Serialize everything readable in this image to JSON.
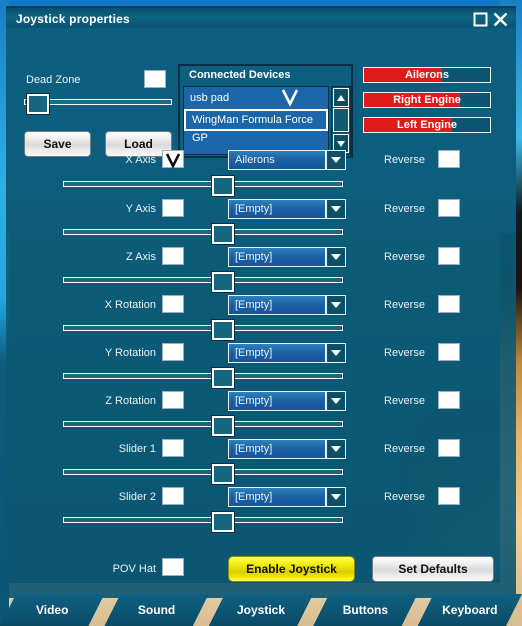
{
  "window": {
    "title": "Joystick properties",
    "maximize_icon": "maximize-icon",
    "close_icon": "close-icon"
  },
  "deadzone": {
    "label": "Dead Zone",
    "checkbox_checked": false,
    "slider_value": 2
  },
  "file_buttons": {
    "save": "Save",
    "load": "Load"
  },
  "connected_devices": {
    "header": "Connected Devices",
    "items": [
      {
        "label": "usb pad",
        "selected": false
      },
      {
        "label": "WingMan Formula Force GP",
        "selected": true
      },
      {
        "label": "",
        "selected": false
      }
    ],
    "scroll_up_icon": "scroll-up-icon",
    "scroll_down_icon": "scroll-down-icon"
  },
  "meters": [
    {
      "label": "Ailerons",
      "value": 62,
      "color": "#e01b1b"
    },
    {
      "label": "Right Engine",
      "value": 76,
      "color": "#e01b1b"
    },
    {
      "label": "Left Engine",
      "value": 70,
      "color": "#e01b1b"
    }
  ],
  "axes": [
    {
      "label": "X Axis",
      "enabled": true,
      "assignment": "Ailerons",
      "reverse_label": "Reverse",
      "reverse": false,
      "slider_value": 57
    },
    {
      "label": "Y Axis",
      "enabled": false,
      "assignment": "[Empty]",
      "reverse_label": "Reverse",
      "reverse": false,
      "slider_value": 57
    },
    {
      "label": "Z Axis",
      "enabled": false,
      "assignment": "[Empty]",
      "reverse_label": "Reverse",
      "reverse": false,
      "slider_value": 57
    },
    {
      "label": "X Rotation",
      "enabled": false,
      "assignment": "[Empty]",
      "reverse_label": "Reverse",
      "reverse": false,
      "slider_value": 57
    },
    {
      "label": "Y Rotation",
      "enabled": false,
      "assignment": "[Empty]",
      "reverse_label": "Reverse",
      "reverse": false,
      "slider_value": 57
    },
    {
      "label": "Z Rotation",
      "enabled": false,
      "assignment": "[Empty]",
      "reverse_label": "Reverse",
      "reverse": false,
      "slider_value": 57
    },
    {
      "label": "Slider 1",
      "enabled": false,
      "assignment": "[Empty]",
      "reverse_label": "Reverse",
      "reverse": false,
      "slider_value": 57
    },
    {
      "label": "Slider 2",
      "enabled": false,
      "assignment": "[Empty]",
      "reverse_label": "Reverse",
      "reverse": false,
      "slider_value": 57
    }
  ],
  "pov": {
    "label": "POV Hat",
    "checked": false
  },
  "actions": {
    "enable_joystick": "Enable Joystick",
    "set_defaults": "Set Defaults"
  },
  "tabs": [
    {
      "label": "Video",
      "active": false
    },
    {
      "label": "Sound",
      "active": false
    },
    {
      "label": "Joystick",
      "active": true
    },
    {
      "label": "Buttons",
      "active": false
    },
    {
      "label": "Keyboard",
      "active": false
    }
  ],
  "colors": {
    "panel": "#0d5f7f",
    "meter_fill": "#e01b1b",
    "enable_button": "#f0e800",
    "titlebar": "#0d6484"
  }
}
